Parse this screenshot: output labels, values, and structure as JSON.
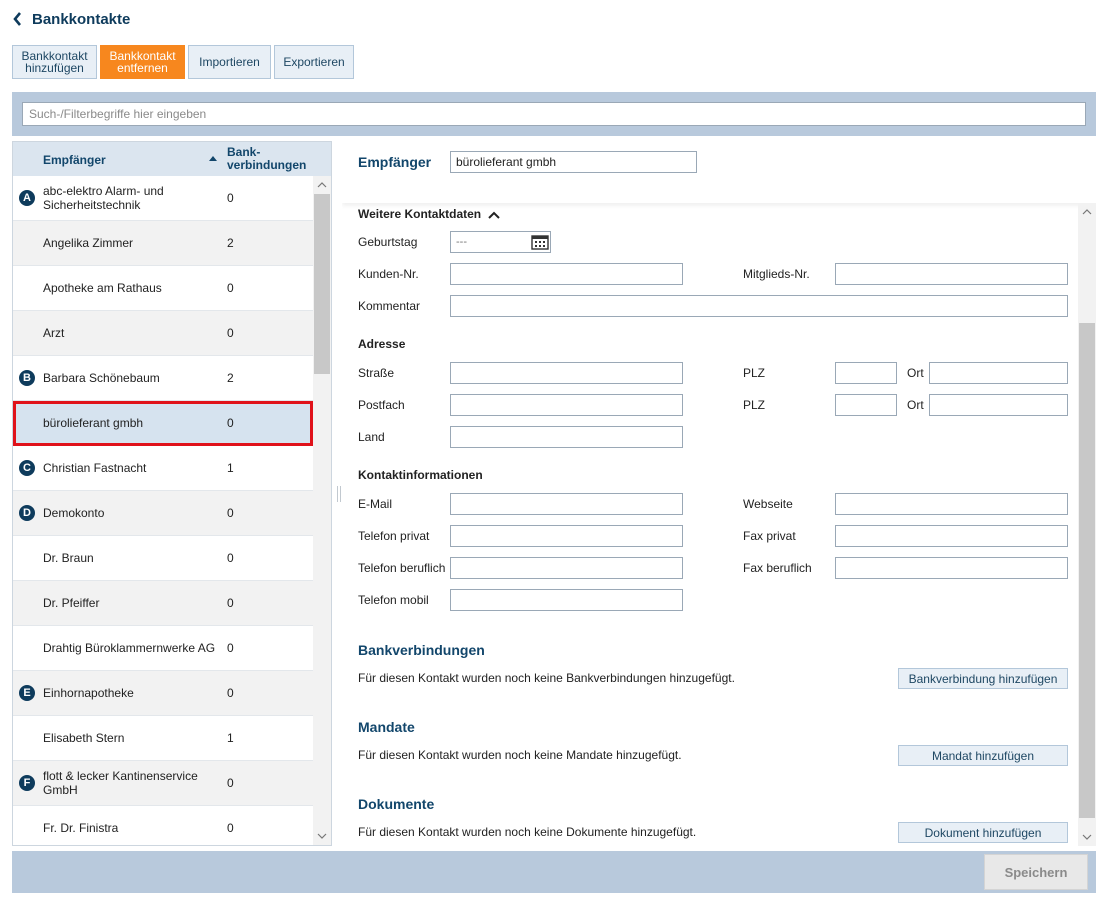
{
  "header": {
    "title": "Bankkontakte",
    "back_icon": "chevron-left-icon"
  },
  "toolbar": {
    "add_label": "Bankkontakt hinzufügen",
    "remove_label": "Bankkontakt entfernen",
    "import_label": "Importieren",
    "export_label": "Exportieren",
    "active": "remove",
    "accent_color": "#f7871e"
  },
  "search": {
    "placeholder": "Such-/Filterbegriffe hier eingeben",
    "value": ""
  },
  "list": {
    "col_name": "Empfänger",
    "col_count": "Bank-\nverbindungen",
    "sort": "ascending",
    "rows": [
      {
        "letter": "A",
        "name": "abc-elektro Alarm- und Sicherheitstechnik",
        "count": "0"
      },
      {
        "letter": "",
        "name": "Angelika Zimmer",
        "count": "2"
      },
      {
        "letter": "",
        "name": "Apotheke am Rathaus",
        "count": "0"
      },
      {
        "letter": "",
        "name": "Arzt",
        "count": "0"
      },
      {
        "letter": "B",
        "name": "Barbara Schönebaum",
        "count": "2"
      },
      {
        "letter": "",
        "name": "bürolieferant gmbh",
        "count": "0"
      },
      {
        "letter": "C",
        "name": "Christian Fastnacht",
        "count": "1"
      },
      {
        "letter": "D",
        "name": "Demokonto",
        "count": "0"
      },
      {
        "letter": "",
        "name": "Dr. Braun",
        "count": "0"
      },
      {
        "letter": "",
        "name": "Dr. Pfeiffer",
        "count": "0"
      },
      {
        "letter": "",
        "name": "Drahtig Büroklammernwerke AG",
        "count": "0"
      },
      {
        "letter": "E",
        "name": "Einhornapotheke",
        "count": "0"
      },
      {
        "letter": "",
        "name": "Elisabeth Stern",
        "count": "1"
      },
      {
        "letter": "F",
        "name": "flott & lecker Kantinenservice GmbH",
        "count": "0"
      },
      {
        "letter": "",
        "name": "Fr. Dr. Finistra",
        "count": "0"
      }
    ],
    "selected_index": 5,
    "selection_color": "#e0121a"
  },
  "detail": {
    "recipient_label": "Empfänger",
    "recipient_value": "bürolieferant gmbh",
    "more_contact": "Weitere Kontaktdaten",
    "birthday_label": "Geburtstag",
    "birthday_placeholder": "---",
    "customer_no_label": "Kunden-Nr.",
    "member_no_label": "Mitglieds-Nr.",
    "comment_label": "Kommentar",
    "address_title": "Adresse",
    "street_label": "Straße",
    "plz_label": "PLZ",
    "ort_label": "Ort",
    "pobox_label": "Postfach",
    "country_label": "Land",
    "contact_title": "Kontaktinformationen",
    "email_label": "E-Mail",
    "website_label": "Webseite",
    "phone_private_label": "Telefon privat",
    "fax_private_label": "Fax privat",
    "phone_business_label": "Telefon beruflich",
    "fax_business_label": "Fax beruflich",
    "phone_mobile_label": "Telefon mobil",
    "bank_title": "Bankverbindungen",
    "bank_empty": "Für diesen Kontakt wurden noch keine Bankverbindungen hinzugefügt.",
    "bank_add": "Bankverbindung hinzufügen",
    "mandate_title": "Mandate",
    "mandate_empty": "Für diesen Kontakt wurden noch keine Mandate hinzugefügt.",
    "mandate_add": "Mandat hinzufügen",
    "docs_title": "Dokumente",
    "docs_empty": "Für diesen Kontakt wurden noch keine Dokumente hinzugefügt.",
    "docs_add": "Dokument hinzufügen"
  },
  "footer": {
    "save_label": "Speichern"
  }
}
